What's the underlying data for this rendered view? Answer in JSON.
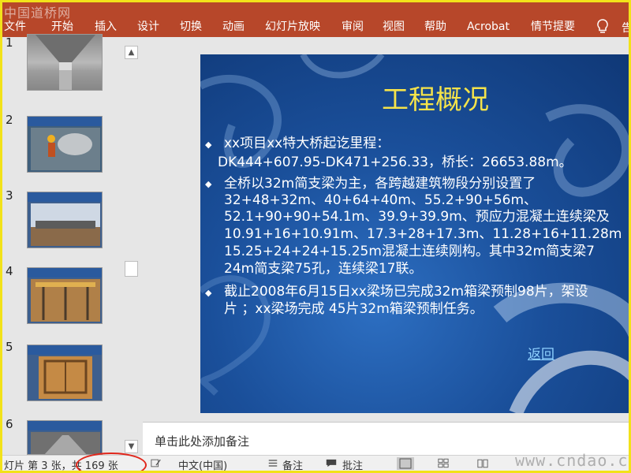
{
  "watermark_top": "中国道桥网",
  "ribbon": {
    "tabs": [
      "文件",
      "开始",
      "插入",
      "设计",
      "切换",
      "动画",
      "幻灯片放映",
      "审阅",
      "视图",
      "帮助",
      "Acrobat",
      "情节提要"
    ],
    "tell_me": "告"
  },
  "thumbnails": {
    "numbers": [
      "1",
      "2",
      "3",
      "4",
      "5",
      "6"
    ]
  },
  "slide": {
    "title": "工程概况",
    "bullets": [
      {
        "lines": [
          "xx项目xx特大桥起讫里程：",
          "DK444+607.95-DK471+256.33，桥长：26653.88m。"
        ]
      },
      {
        "lines": [
          "全桥以32m简支梁为主，各跨越建筑物段分别设置了",
          "32+48+32m、40+64+40m、55.2+90+56m、",
          "52.1+90+90+54.1m、39.9+39.9m、预应力混凝土连续梁及",
          "10.91+16+10.91m、17.3+28+17.3m、11.28+16+11.28m",
          "15.25+24+24+15.25m混凝土连续刚构。其中32m简支梁7",
          "24m简支梁75孔，连续梁17联。"
        ]
      },
      {
        "lines": [
          "截止2008年6月15日xx梁场已完成32m箱梁预制98片，架设",
          "片 ；xx梁场完成 45片32m箱梁预制任务。"
        ]
      }
    ],
    "back_link": "返回"
  },
  "notes": {
    "placeholder": "单击此处添加备注"
  },
  "status": {
    "slide_count": "灯片 第 3 张，共 169 张",
    "language": "中文(中国)",
    "notes_label": "备注",
    "comments_label": "批注"
  },
  "watermark_bottom": "www.cndao.com",
  "colors": {
    "ribbon": "#b7472a",
    "title": "#f5e34a",
    "highlight_circle": "#e0261b"
  }
}
